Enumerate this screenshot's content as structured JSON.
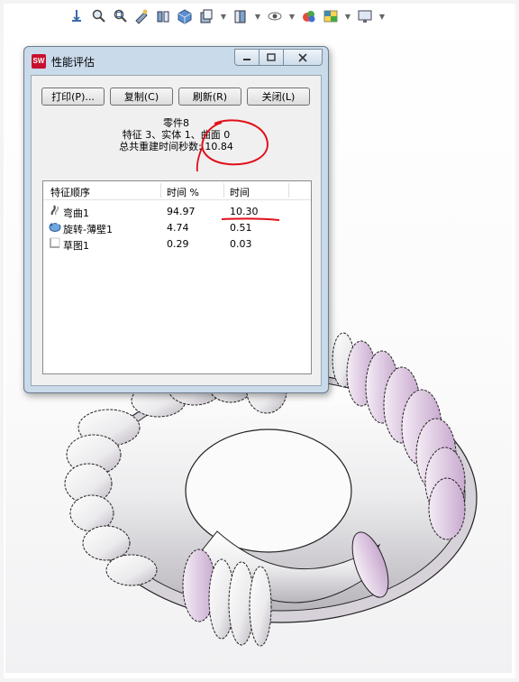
{
  "window": {
    "title": "性能评估",
    "buttons": {
      "print": "打印(P)...",
      "copy": "复制(C)",
      "refresh": "刷新(R)",
      "close": "关闭(L)"
    },
    "summary": {
      "part_name": "零件8",
      "counts": "特征 3、实体 1、曲面 0",
      "rebuild_time": "总共重建时间秒数: 10.84"
    },
    "table": {
      "headers": [
        "特征顺序",
        "时间 %",
        "时间"
      ],
      "rows": [
        {
          "name": "弯曲1",
          "percent": "94.97",
          "time": "10.30",
          "icon": "flex-feature-icon"
        },
        {
          "name": "旋转-薄壁1",
          "percent": "4.74",
          "time": "0.51",
          "icon": "revolve-thin-icon"
        },
        {
          "name": "草图1",
          "percent": "0.29",
          "time": "0.03",
          "icon": "sketch-icon"
        }
      ]
    }
  },
  "toolbar": {
    "icons": [
      "view-orientation-icon",
      "zoom-to-fit-icon",
      "zoom-area-icon",
      "previous-view-icon",
      "section-view-icon",
      "view-orientation-cube-icon",
      "display-style-icon",
      "hide-show-icon",
      "edit-appearance-icon",
      "apply-scene-icon",
      "view-settings-icon"
    ]
  },
  "colors": {
    "dialog_frame": "#c9daea",
    "annotation_red": "#e0101a",
    "model_body": "#f3f3f3",
    "model_shadow": "#c9b6cf"
  }
}
